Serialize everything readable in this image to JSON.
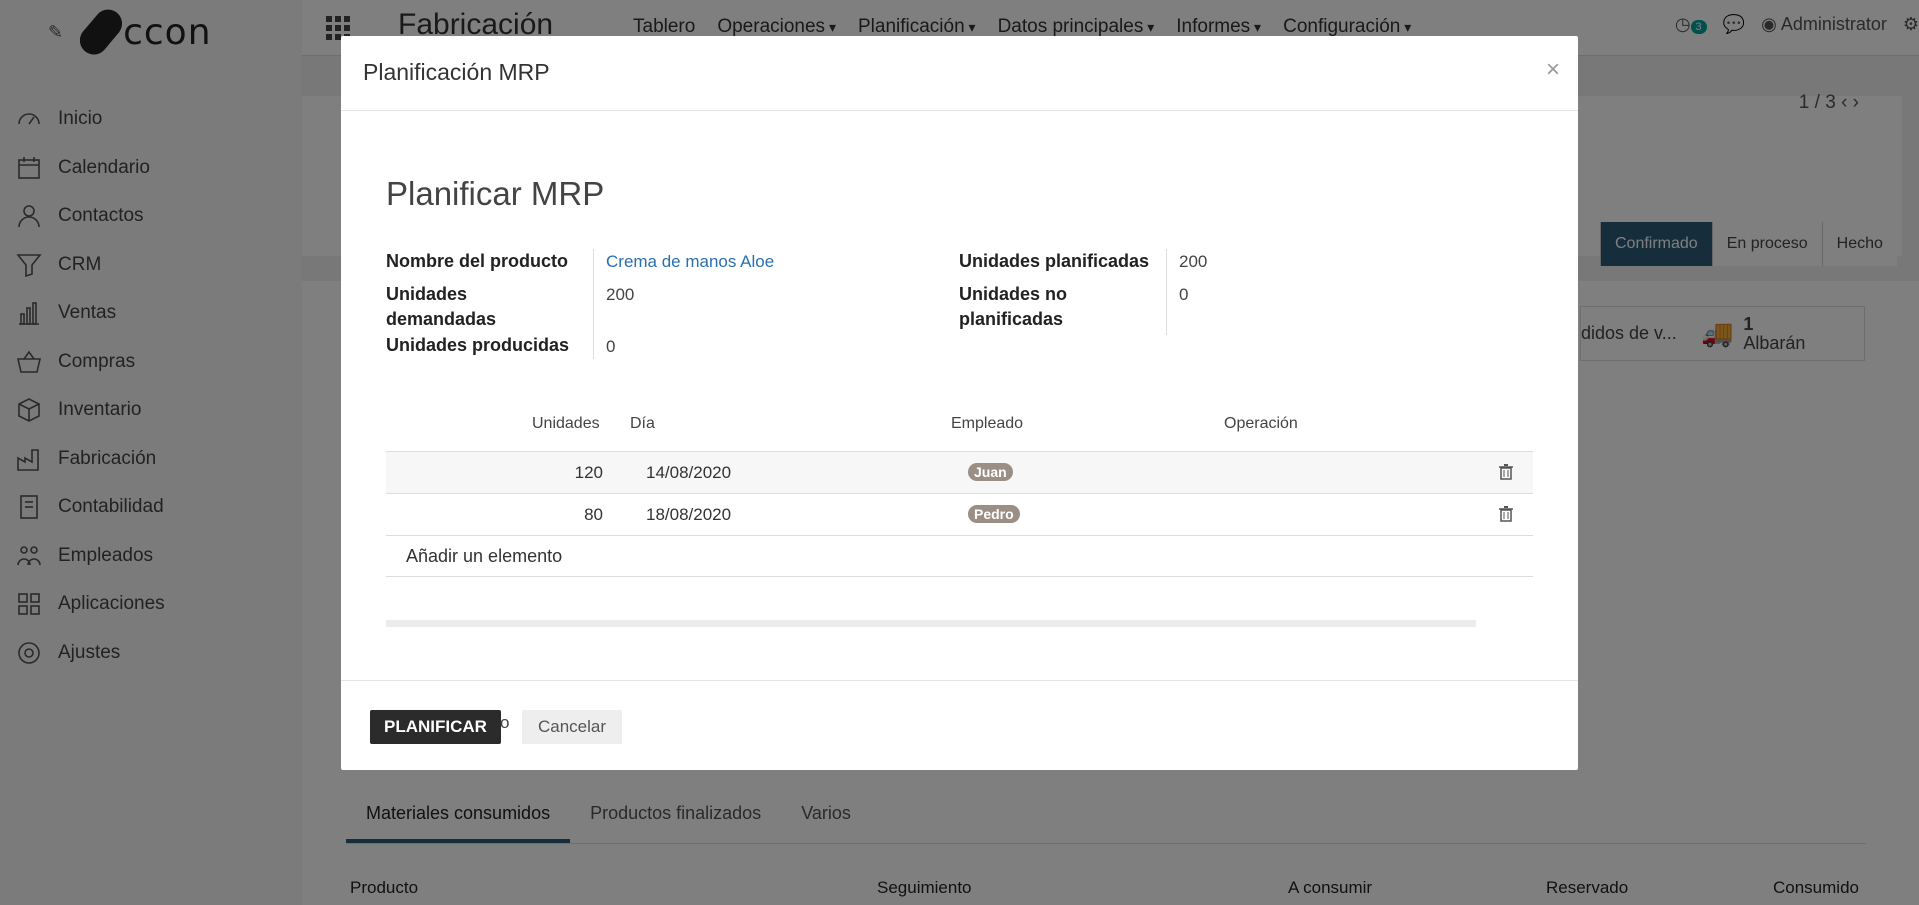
{
  "logo_text": "ccon",
  "sidebar": {
    "items": [
      {
        "label": "Inicio",
        "icon": "dashboard-icon"
      },
      {
        "label": "Calendario",
        "icon": "calendar-icon"
      },
      {
        "label": "Contactos",
        "icon": "user-icon"
      },
      {
        "label": "CRM",
        "icon": "filter-icon"
      },
      {
        "label": "Ventas",
        "icon": "bar-chart-icon"
      },
      {
        "label": "Compras",
        "icon": "basket-icon"
      },
      {
        "label": "Inventario",
        "icon": "box-icon"
      },
      {
        "label": "Fabricación",
        "icon": "factory-icon"
      },
      {
        "label": "Contabilidad",
        "icon": "invoice-icon"
      },
      {
        "label": "Empleados",
        "icon": "people-icon"
      },
      {
        "label": "Aplicaciones",
        "icon": "grid-icon"
      },
      {
        "label": "Ajustes",
        "icon": "gear-icon"
      }
    ]
  },
  "topbar": {
    "module_title": "Fabricación",
    "menu": [
      "Tablero",
      "Operaciones",
      "Planificación",
      "Datos principales",
      "Informes",
      "Configuración"
    ],
    "notification_count": "3",
    "user": "Administrator"
  },
  "background": {
    "pager": "1 / 3",
    "status": [
      "Confirmado",
      "En proceso",
      "Hecho"
    ],
    "smart_button": {
      "count": "1",
      "label": "Albarán",
      "partial": "didos de v..."
    },
    "tabs": [
      "Materiales consumidos",
      "Productos finalizados",
      "Varios"
    ],
    "table_headers": [
      "Producto",
      "Seguimiento",
      "A consumir",
      "Reservado",
      "Consumido"
    ]
  },
  "modal": {
    "title": "Planificación MRP",
    "form_title": "Planificar MRP",
    "fields": {
      "product_label": "Nombre del producto",
      "product_value": "Crema de manos Aloe",
      "demanded_label_1": "Unidades",
      "demanded_label_2": "demandadas",
      "demanded_value": "200",
      "produced_label": "Unidades producidas",
      "produced_value": "0",
      "planned_label": "Unidades planificadas",
      "planned_value": "200",
      "unplanned_label_1": "Unidades no",
      "unplanned_label_2": "planificadas",
      "unplanned_value": "0"
    },
    "table": {
      "headers": {
        "units": "Unidades",
        "day": "Día",
        "employee": "Empleado",
        "operation": "Operación"
      },
      "rows": [
        {
          "units": "120",
          "day": "14/08/2020",
          "employee": "Juan",
          "operation": ""
        },
        {
          "units": "80",
          "day": "18/08/2020",
          "employee": "Pedro",
          "operation": ""
        }
      ],
      "add_label": "Añadir un elemento"
    },
    "footer": {
      "plan": "PLANIFICAR",
      "or": "o",
      "cancel": "Cancelar"
    }
  }
}
